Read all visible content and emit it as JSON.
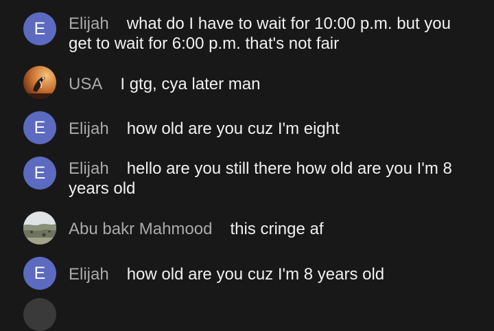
{
  "messages": [
    {
      "author": "Elijah",
      "avatar_letter": "E",
      "text": "what do I have to wait for 10:00 p.m. but you get to wait for 6:00 p.m. that's not fair"
    },
    {
      "author": "USA",
      "avatar_image": "bird-photo",
      "text": "I gtg, cya later man"
    },
    {
      "author": "Elijah",
      "avatar_letter": "E",
      "text": "how old are you cuz I'm eight"
    },
    {
      "author": "Elijah",
      "avatar_letter": "E",
      "text": "hello are you still there how old are you I'm 8 years old"
    },
    {
      "author": "Abu bakr Mahmood",
      "avatar_image": "landscape-photo",
      "text": "this cringe af"
    },
    {
      "author": "Elijah",
      "avatar_letter": "E",
      "text": "how old are you cuz I'm 8 years old"
    }
  ],
  "colors": {
    "background": "#181818",
    "author": "#aaaaaa",
    "message": "#f1f1f1",
    "avatar_letter_bg": "#5c6bc0"
  }
}
